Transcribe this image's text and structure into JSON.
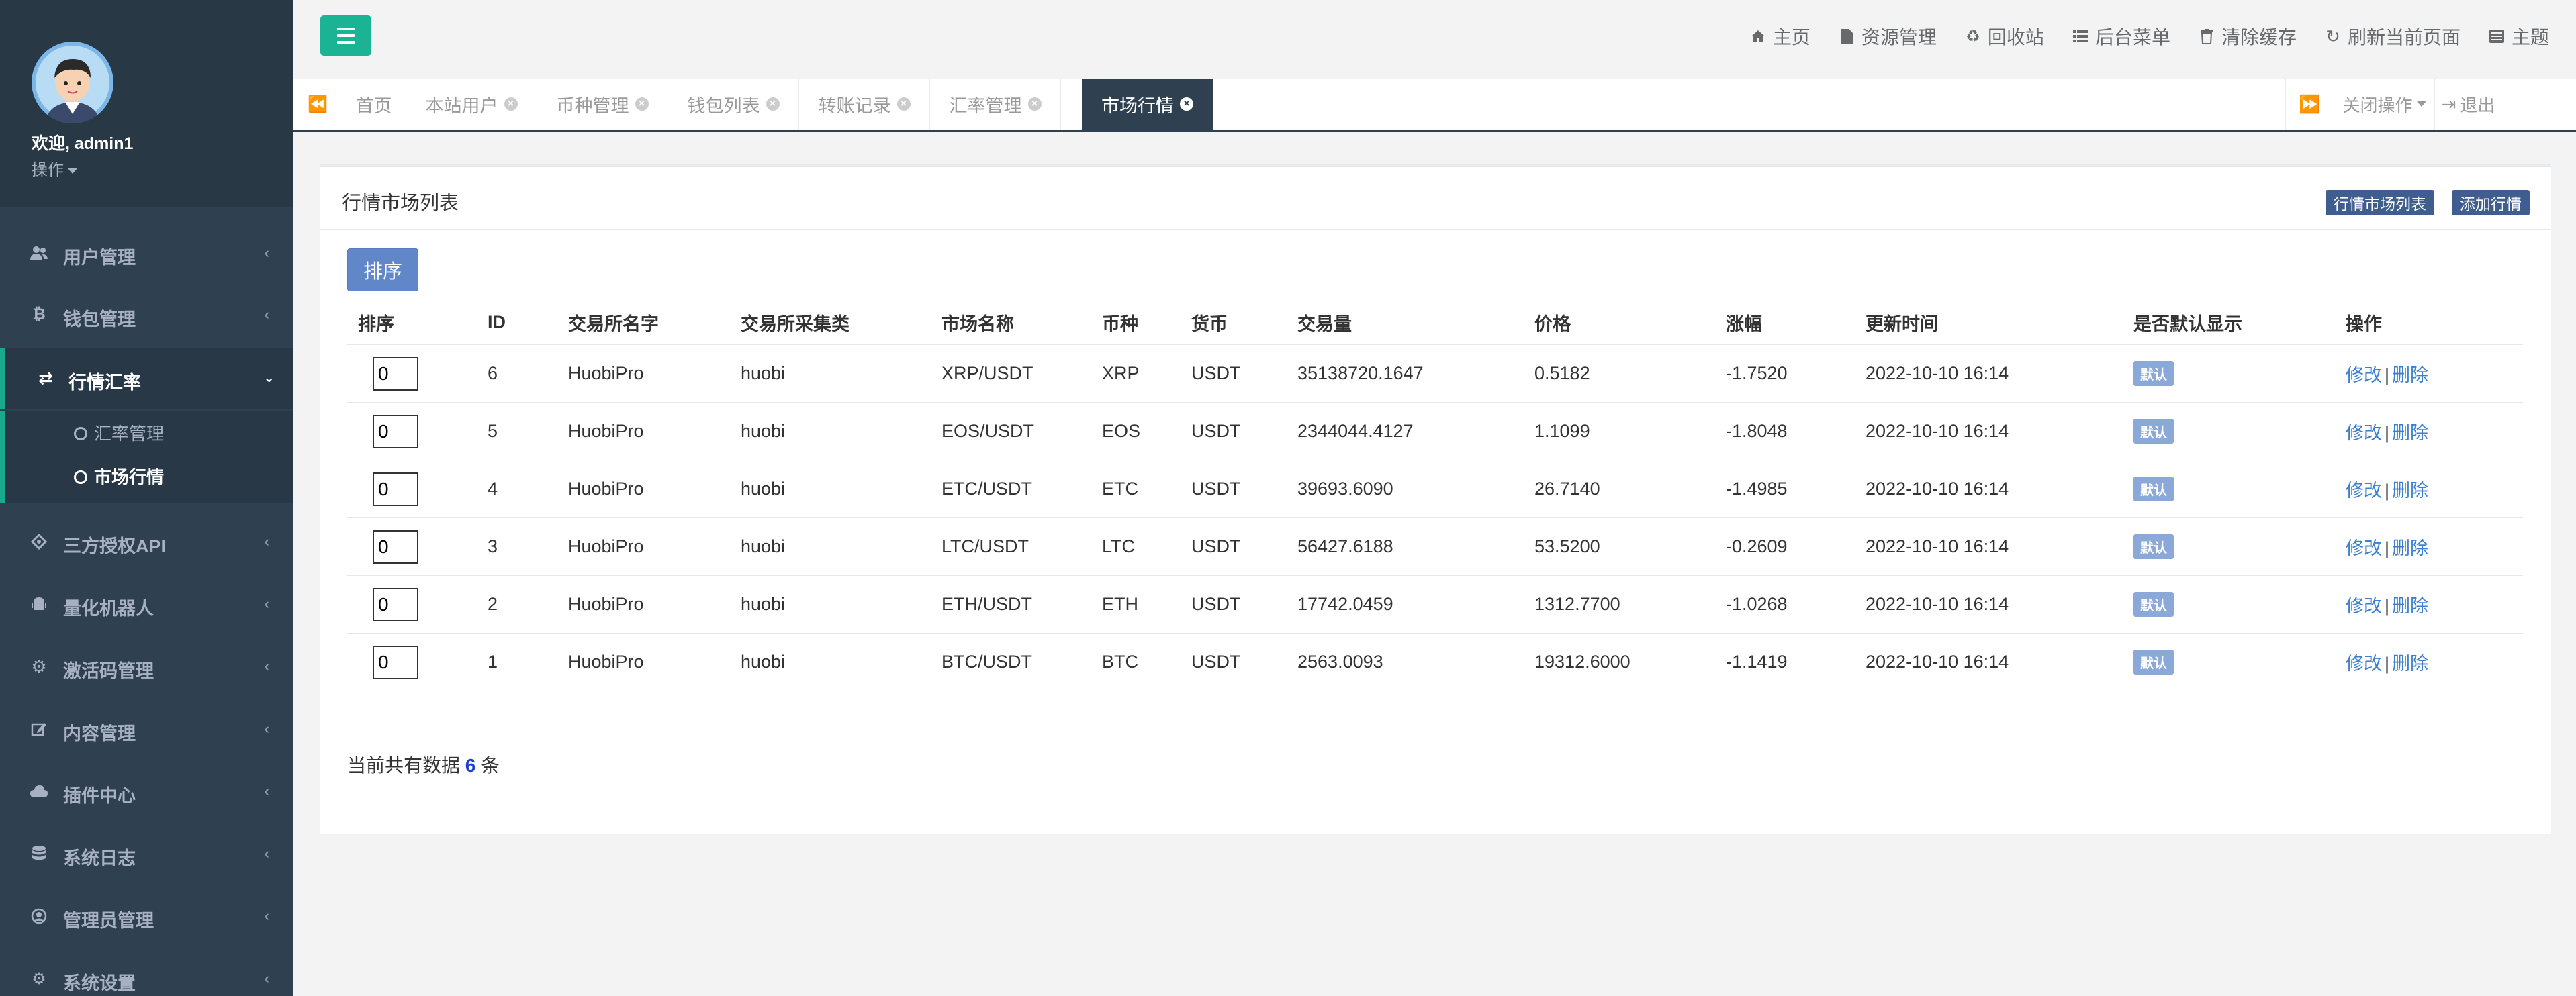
{
  "sidebar": {
    "welcome": "欢迎, admin1",
    "op_label": "操作",
    "menu": [
      {
        "label": "用户管理",
        "icon": "users-icon"
      },
      {
        "label": "钱包管理",
        "icon": "bitcoin-icon"
      },
      {
        "label": "行情汇率",
        "icon": "exchange-icon"
      },
      {
        "label": "三方授权API",
        "icon": "network-icon"
      },
      {
        "label": "量化机器人",
        "icon": "android-icon"
      },
      {
        "label": "激活码管理",
        "icon": "gear-icon"
      },
      {
        "label": "内容管理",
        "icon": "edit-icon"
      },
      {
        "label": "插件中心",
        "icon": "cloud-icon"
      },
      {
        "label": "系统日志",
        "icon": "database-icon"
      },
      {
        "label": "管理员管理",
        "icon": "user-circle-icon"
      },
      {
        "label": "系统设置",
        "icon": "gears-icon"
      }
    ],
    "submenu": [
      "汇率管理",
      "市场行情"
    ]
  },
  "topnav": {
    "links": [
      {
        "label": "主页",
        "icon": "home-icon"
      },
      {
        "label": "资源管理",
        "icon": "file-icon"
      },
      {
        "label": "回收站",
        "icon": "recycle-icon"
      },
      {
        "label": "后台菜单",
        "icon": "list-icon"
      },
      {
        "label": "清除缓存",
        "icon": "trash-icon"
      },
      {
        "label": "刷新当前页面",
        "icon": "refresh-icon"
      },
      {
        "label": "主题",
        "icon": "theme-icon"
      }
    ]
  },
  "tabs": {
    "items": [
      "首页",
      "本站用户",
      "币种管理",
      "钱包列表",
      "转账记录",
      "汇率管理",
      "市场行情"
    ],
    "close_ops": "关闭操作",
    "logout": "退出"
  },
  "panel": {
    "title": "行情市场列表",
    "btn_list": "行情市场列表",
    "btn_add": "添加行情",
    "sort_button": "排序",
    "columns": [
      "排序",
      "ID",
      "交易所名字",
      "交易所采集类",
      "市场名称",
      "币种",
      "货币",
      "交易量",
      "价格",
      "涨幅",
      "更新时间",
      "是否默认显示",
      "操作"
    ],
    "rows": [
      {
        "sort": "0",
        "id": "6",
        "exchange": "HuobiPro",
        "collector": "huobi",
        "market": "XRP/USDT",
        "coin": "XRP",
        "currency": "USDT",
        "volume": "35138720.1647",
        "price": "0.5182",
        "change": "-1.7520",
        "updated": "2022-10-10 16:14",
        "default": "默认",
        "edit": "修改",
        "delete": "删除"
      },
      {
        "sort": "0",
        "id": "5",
        "exchange": "HuobiPro",
        "collector": "huobi",
        "market": "EOS/USDT",
        "coin": "EOS",
        "currency": "USDT",
        "volume": "2344044.4127",
        "price": "1.1099",
        "change": "-1.8048",
        "updated": "2022-10-10 16:14",
        "default": "默认",
        "edit": "修改",
        "delete": "删除"
      },
      {
        "sort": "0",
        "id": "4",
        "exchange": "HuobiPro",
        "collector": "huobi",
        "market": "ETC/USDT",
        "coin": "ETC",
        "currency": "USDT",
        "volume": "39693.6090",
        "price": "26.7140",
        "change": "-1.4985",
        "updated": "2022-10-10 16:14",
        "default": "默认",
        "edit": "修改",
        "delete": "删除"
      },
      {
        "sort": "0",
        "id": "3",
        "exchange": "HuobiPro",
        "collector": "huobi",
        "market": "LTC/USDT",
        "coin": "LTC",
        "currency": "USDT",
        "volume": "56427.6188",
        "price": "53.5200",
        "change": "-0.2609",
        "updated": "2022-10-10 16:14",
        "default": "默认",
        "edit": "修改",
        "delete": "删除"
      },
      {
        "sort": "0",
        "id": "2",
        "exchange": "HuobiPro",
        "collector": "huobi",
        "market": "ETH/USDT",
        "coin": "ETH",
        "currency": "USDT",
        "volume": "17742.0459",
        "price": "1312.7700",
        "change": "-1.0268",
        "updated": "2022-10-10 16:14",
        "default": "默认",
        "edit": "修改",
        "delete": "删除"
      },
      {
        "sort": "0",
        "id": "1",
        "exchange": "HuobiPro",
        "collector": "huobi",
        "market": "BTC/USDT",
        "coin": "BTC",
        "currency": "USDT",
        "volume": "2563.0093",
        "price": "19312.6000",
        "change": "-1.1419",
        "updated": "2022-10-10 16:14",
        "default": "默认",
        "edit": "修改",
        "delete": "删除"
      }
    ],
    "footer_prefix": "当前共有数据",
    "footer_count": "6",
    "footer_suffix": "条"
  },
  "colors": {
    "sidebar_bg": "#2f4050",
    "accent_green": "#1ab394",
    "active_tab": "#2f4050",
    "badge": "#8aa8d8",
    "link": "#3a7fd0"
  }
}
